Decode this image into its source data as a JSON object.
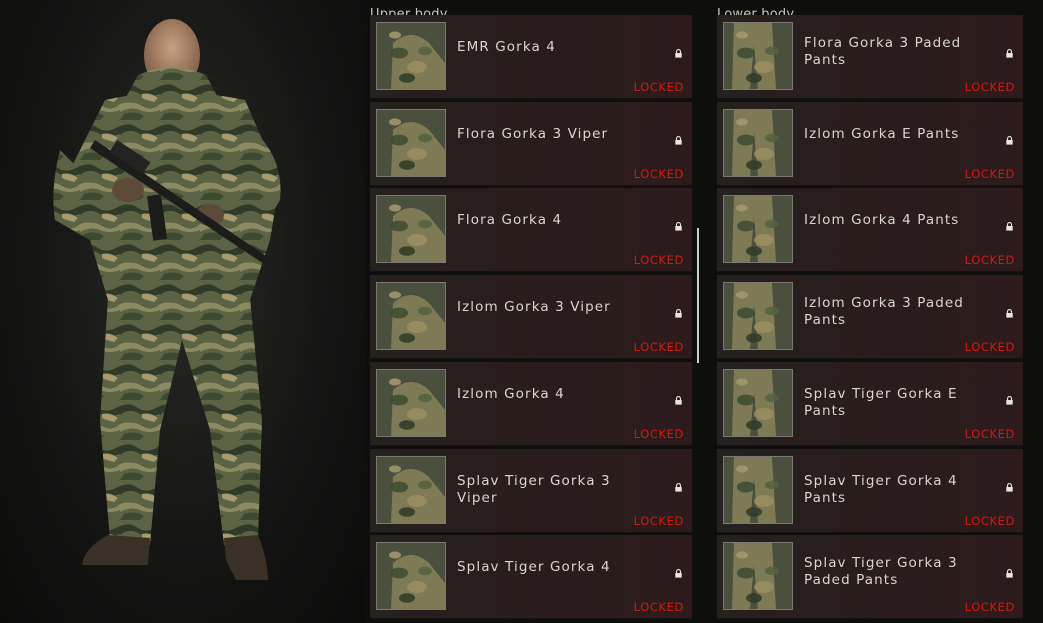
{
  "upper": {
    "title": "Upper body",
    "items": [
      {
        "name": "EMR Gorka 4",
        "status": "LOCKED",
        "icon": "lock-icon",
        "thumb": "jacket-emr"
      },
      {
        "name": "Flora Gorka 3 Viper",
        "status": "LOCKED",
        "icon": "lock-icon",
        "thumb": "jacket-flora-viper"
      },
      {
        "name": "Flora Gorka 4",
        "status": "LOCKED",
        "icon": "lock-icon",
        "thumb": "jacket-flora"
      },
      {
        "name": "Izlom Gorka 3 Viper",
        "status": "LOCKED",
        "icon": "lock-icon",
        "thumb": "jacket-izlom-viper"
      },
      {
        "name": "Izlom Gorka 4",
        "status": "LOCKED",
        "icon": "lock-icon",
        "thumb": "jacket-izlom"
      },
      {
        "name": "Splav Tiger Gorka 3 Viper",
        "status": "LOCKED",
        "icon": "lock-icon",
        "thumb": "jacket-splav-viper"
      },
      {
        "name": "Splav Tiger Gorka 4",
        "status": "LOCKED",
        "icon": "lock-icon",
        "thumb": "jacket-splav"
      }
    ]
  },
  "lower": {
    "title": "Lower body",
    "items": [
      {
        "name": "Flora Gorka 3 Paded Pants",
        "status": "LOCKED",
        "icon": "lock-icon",
        "thumb": "pants-flora-paded"
      },
      {
        "name": "Izlom Gorka E Pants",
        "status": "LOCKED",
        "icon": "lock-icon",
        "thumb": "pants-izlom-e"
      },
      {
        "name": "Izlom Gorka 4 Pants",
        "status": "LOCKED",
        "icon": "lock-icon",
        "thumb": "pants-izlom-4"
      },
      {
        "name": "Izlom Gorka 3 Paded Pants",
        "status": "LOCKED",
        "icon": "lock-icon",
        "thumb": "pants-izlom-paded"
      },
      {
        "name": "Splav Tiger Gorka E Pants",
        "status": "LOCKED",
        "icon": "lock-icon",
        "thumb": "pants-splav-e"
      },
      {
        "name": "Splav Tiger Gorka 4 Pants",
        "status": "LOCKED",
        "icon": "lock-icon",
        "thumb": "pants-splav-4"
      },
      {
        "name": "Splav Tiger Gorka 3 Paded Pants",
        "status": "LOCKED",
        "icon": "lock-icon",
        "thumb": "pants-splav-paded"
      }
    ]
  },
  "colors": {
    "locked": "#d21a14",
    "item_bg": "#2a1c1c",
    "camo_green": "#4d5a3a",
    "camo_tan": "#8a8258",
    "camo_dark": "#2e3526"
  }
}
